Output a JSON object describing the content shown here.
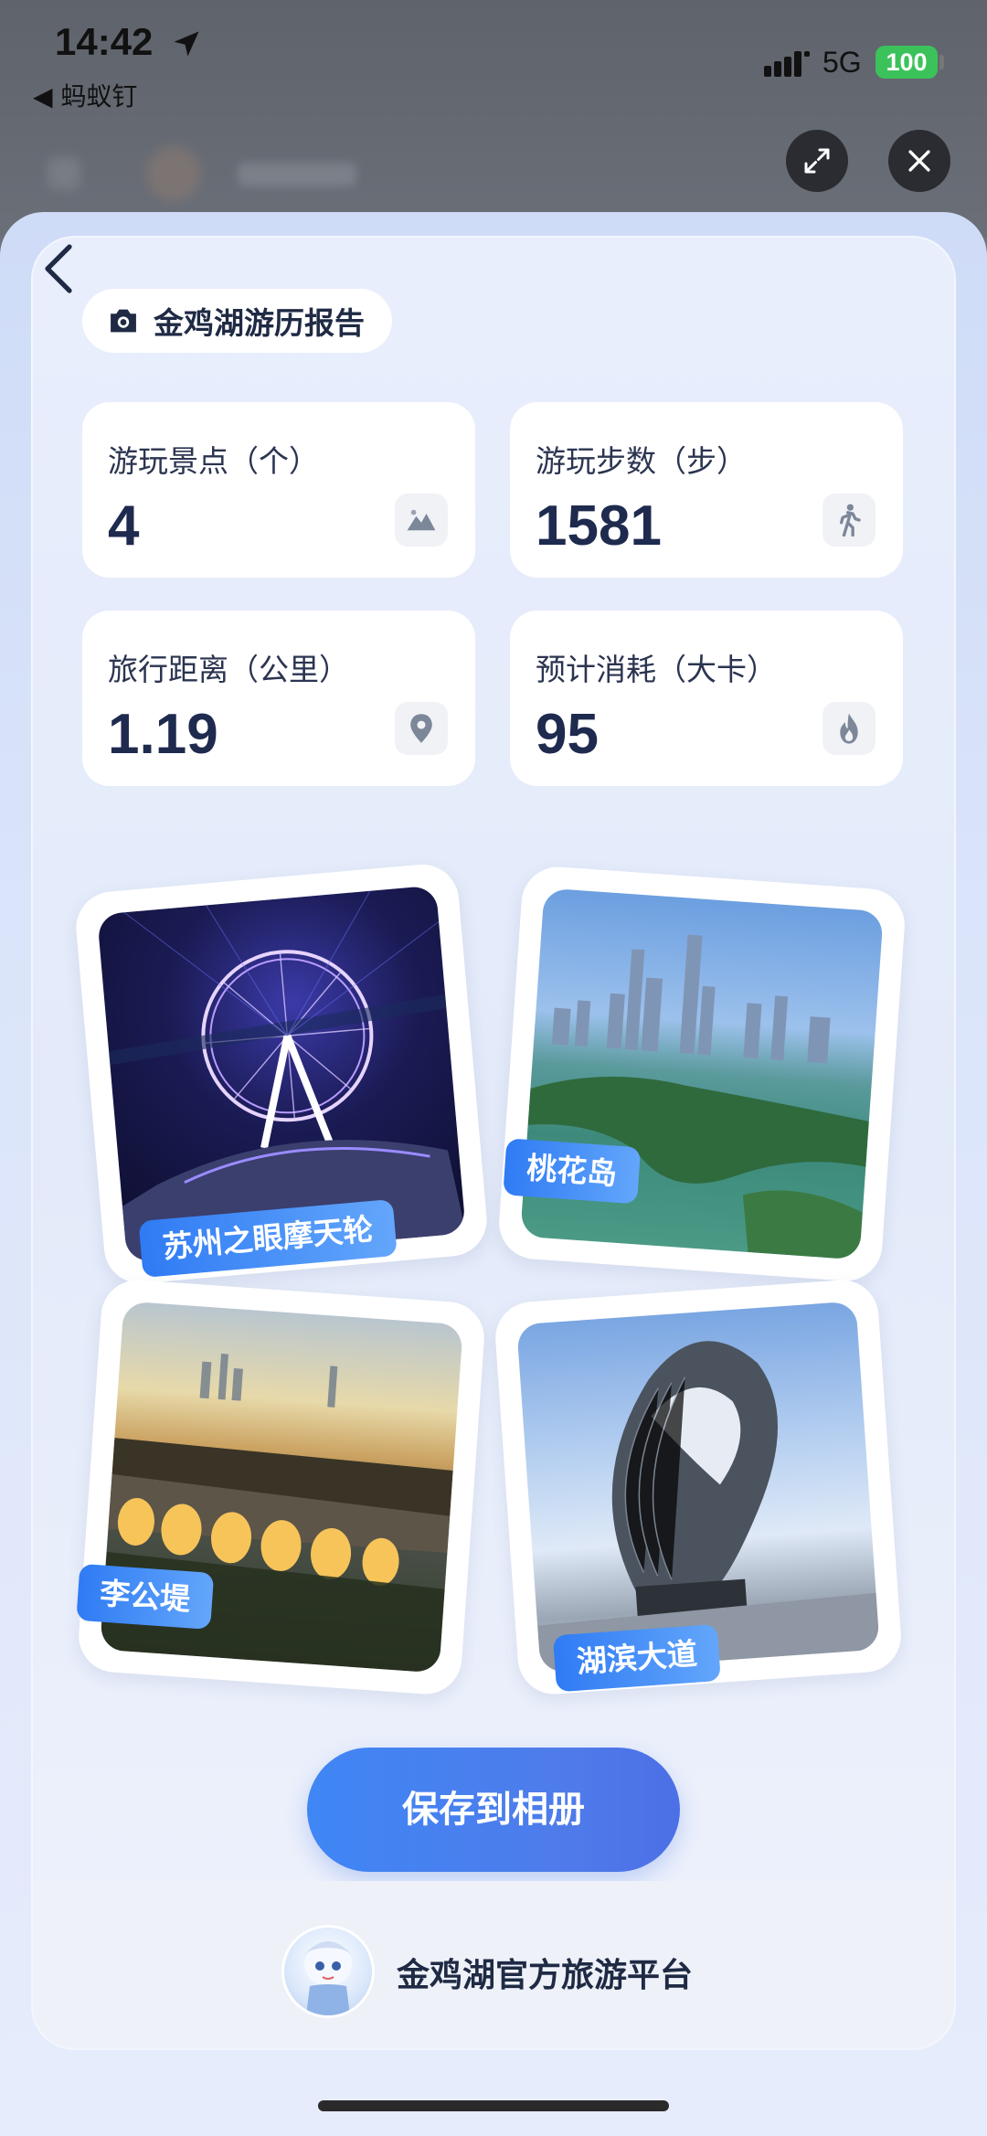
{
  "status_bar": {
    "time": "14:42",
    "back_app": "◀ 蚂蚁钉",
    "network": "5G",
    "battery": "100"
  },
  "report": {
    "title": "金鸡湖游历报告"
  },
  "stats": [
    {
      "label": "游玩景点（个）",
      "value": "4",
      "icon": "mountain-icon"
    },
    {
      "label": "游玩步数（步）",
      "value": "1581",
      "icon": "walking-icon"
    },
    {
      "label": "旅行距离（公里）",
      "value": "1.19",
      "icon": "location-pin-icon"
    },
    {
      "label": "预计消耗（大卡）",
      "value": "95",
      "icon": "flame-icon"
    }
  ],
  "photos": [
    {
      "caption": "苏州之眼摩天轮"
    },
    {
      "caption": "桃花岛"
    },
    {
      "caption": "李公堤"
    },
    {
      "caption": "湖滨大道"
    }
  ],
  "actions": {
    "save_label": "保存到相册"
  },
  "footer": {
    "platform_name": "金鸡湖官方旅游平台"
  },
  "colors": {
    "accent": "#3f86f5",
    "tag_gradient_start": "#2f7bf4",
    "battery_green": "#3cc25a"
  }
}
